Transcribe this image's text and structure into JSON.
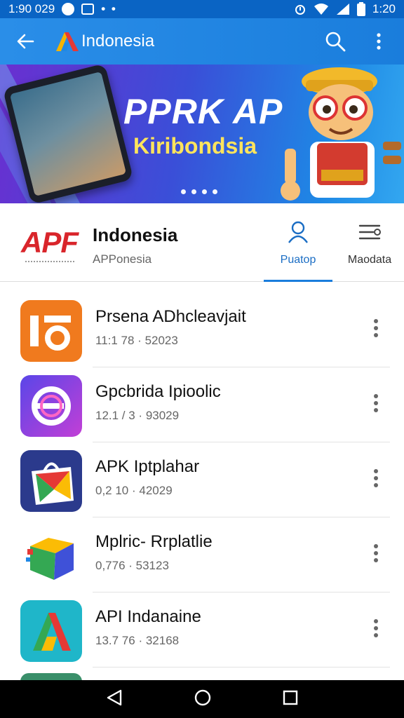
{
  "status_bar": {
    "left_time": "1:90 029",
    "dots": "• •",
    "right_time": "1:20"
  },
  "app_bar": {
    "title": "Indonesia"
  },
  "banner": {
    "title": "PPRK AP",
    "subtitle": "Kiribondsia",
    "page_indicator": {
      "count": 4
    }
  },
  "info": {
    "brand_logo": "APF",
    "brand_name": "Indonesia",
    "brand_sub": "APPonesia",
    "tabs": [
      {
        "label": "Puatop",
        "icon": "person-icon",
        "selected": true
      },
      {
        "label": "Maodata",
        "icon": "menu-settings-icon",
        "selected": false
      }
    ]
  },
  "apps": [
    {
      "title": "Prsena ADhcleavjait",
      "sub": "11:1 78 · 52023",
      "icon": "orange-tile-icon",
      "color": "#f07a1e"
    },
    {
      "title": "Gpcbrida Ipioolic",
      "sub": "12.1 / 3 · 93029",
      "icon": "purple-swirl-icon",
      "color": "#6a3fe0"
    },
    {
      "title": "APK Iptplahar",
      "sub": "0,2 10 · 42029",
      "icon": "shopping-bag-icon",
      "color": "#2b3a8c"
    },
    {
      "title": "Mplric- Rrplatlie",
      "sub": "0,776 · 53123",
      "icon": "cube-icon",
      "color": "#f5a623"
    },
    {
      "title": "API Indanaine",
      "sub": "13.7 76 · 32168",
      "icon": "a-letter-icon",
      "color": "#1fb6c9"
    }
  ],
  "colors": {
    "accent": "#1a7ddc",
    "status_bar": "#0a64c4",
    "brand_red": "#d9252b"
  }
}
